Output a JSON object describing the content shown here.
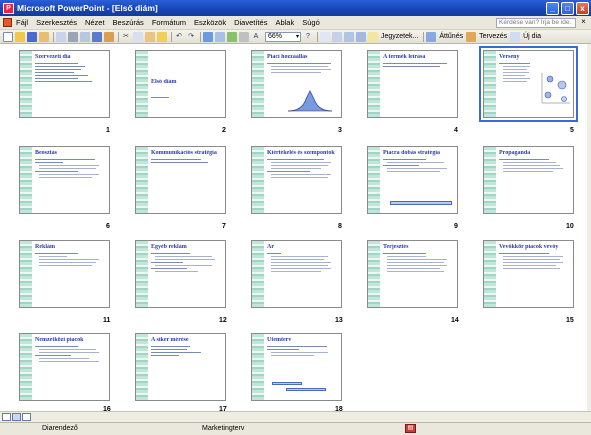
{
  "window": {
    "title": "Microsoft PowerPoint - [Első diám]",
    "minimize": "_",
    "maximize": "□",
    "close": "x"
  },
  "menubar": {
    "items": [
      {
        "label": "Fájl"
      },
      {
        "label": "Szerkesztés"
      },
      {
        "label": "Nézet"
      },
      {
        "label": "Beszúrás"
      },
      {
        "label": "Formátum"
      },
      {
        "label": "Eszközök"
      },
      {
        "label": "Diavetítés"
      },
      {
        "label": "Ablak"
      },
      {
        "label": "Súgó"
      }
    ],
    "help_placeholder": "Kérdése van? Írja be ide.",
    "close_doc": "×"
  },
  "toolbar": {
    "zoom_value": "66%",
    "notes_label": "Jegyzetek...",
    "transition_label": "Áttűnés",
    "design_label": "Tervezés",
    "new_slide_label": "Új dia"
  },
  "slides": [
    {
      "num": "1",
      "title": "Szervezeti dia"
    },
    {
      "num": "2",
      "title": "Első diám"
    },
    {
      "num": "3",
      "title": "Piaci hozzáállás"
    },
    {
      "num": "4",
      "title": "A termék leírása"
    },
    {
      "num": "5",
      "title": "Verseny"
    },
    {
      "num": "6",
      "title": "Beosztás"
    },
    {
      "num": "7",
      "title": "Kommunikációs stratégia"
    },
    {
      "num": "8",
      "title": "Kiértékelés és szempontok"
    },
    {
      "num": "9",
      "title": "Piacra dobás stratégia"
    },
    {
      "num": "10",
      "title": "Propaganda"
    },
    {
      "num": "11",
      "title": "Reklám"
    },
    {
      "num": "12",
      "title": "Egyéb reklám"
    },
    {
      "num": "13",
      "title": "Ár"
    },
    {
      "num": "14",
      "title": "Terjesztés"
    },
    {
      "num": "15",
      "title": "Vevőkkör piacok vevőy"
    },
    {
      "num": "16",
      "title": "Nemzetközi piacok"
    },
    {
      "num": "17",
      "title": "A siker mérése"
    },
    {
      "num": "18",
      "title": "Ütemterv"
    }
  ],
  "statusbar": {
    "view": "Diarendező",
    "design": "Marketingterv"
  }
}
